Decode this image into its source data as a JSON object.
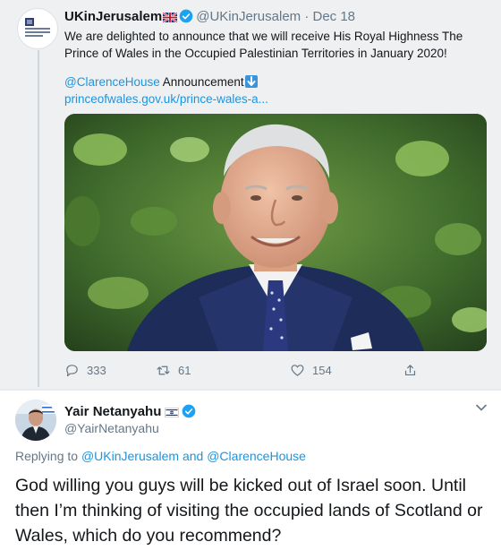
{
  "original_tweet": {
    "author_name": "UKinJerusalem",
    "author_handle": "@UKinJerusalem",
    "separator": "·",
    "date": "Dec 18",
    "text": "We are delighted to announce that we will receive His Royal Highness The Prince of Wales in the Occupied Palestinian Territories in January 2020!",
    "mention_line": {
      "mention": "@ClarenceHouse",
      "word": "Announcement"
    },
    "link_text": "princeofwales.gov.uk/prince-wales-a...",
    "stats": {
      "replies": "333",
      "retweets": "61",
      "likes": "154"
    }
  },
  "reply_tweet": {
    "author_name": "Yair Netanyahu",
    "author_handle": "@YairNetanyahu",
    "replying_prefix": "Replying to",
    "replying_user1": "@UKinJerusalem",
    "replying_and": "and",
    "replying_user2": "@ClarenceHouse",
    "text": "God willing you guys will be kicked out of Israel soon. Until then I’m thinking of visiting the occupied lands of Scotland or Wales, which do you recommend?"
  },
  "colors": {
    "link_blue": "#1b95e0",
    "verified_blue": "#1da1f2",
    "muted_gray": "#657786"
  },
  "icons": [
    "verified-badge-icon",
    "uk-flag-icon",
    "israel-flag-icon",
    "down-arrow-emoji-icon",
    "reply-icon",
    "retweet-icon",
    "like-icon",
    "share-icon",
    "chevron-down-icon"
  ]
}
